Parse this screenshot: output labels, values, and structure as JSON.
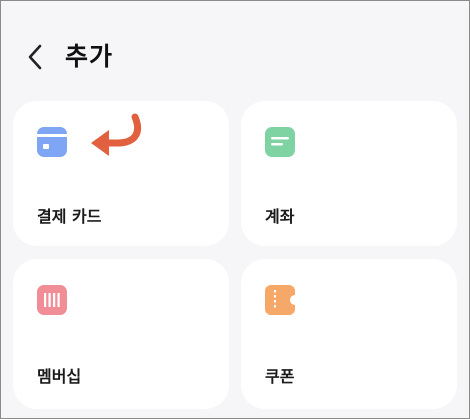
{
  "header": {
    "title": "추가",
    "back_icon": "chevron-left-icon"
  },
  "cards": [
    {
      "label": "결제 카드",
      "icon": "card-icon",
      "color": "#7ea6f4"
    },
    {
      "label": "계좌",
      "icon": "account-icon",
      "color": "#7fd3a3"
    },
    {
      "label": "멤버십",
      "icon": "membership-barcode-icon",
      "color": "#f08d97"
    },
    {
      "label": "쿠폰",
      "icon": "coupon-icon",
      "color": "#f5a867"
    }
  ],
  "annotation": {
    "icon": "curved-arrow-icon",
    "color": "#e0603f"
  },
  "colors": {
    "background": "#f6f6f8",
    "card_background": "#ffffff",
    "text": "#111111"
  }
}
